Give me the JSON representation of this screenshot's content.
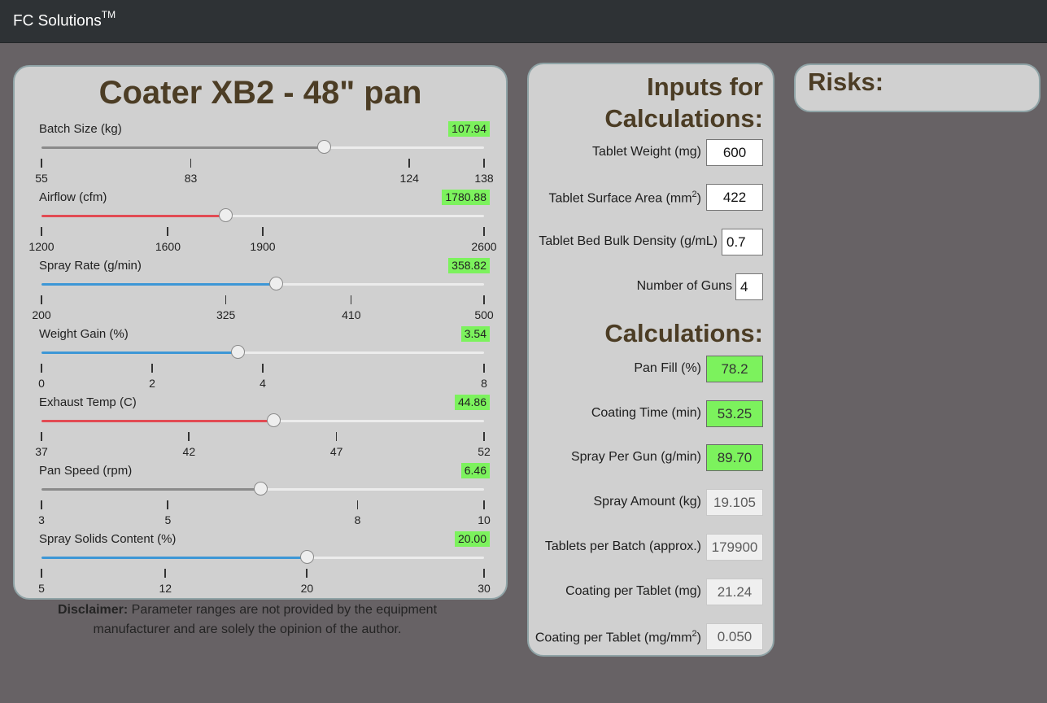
{
  "header": {
    "brand": "FC Solutions",
    "brand_mark": "TM"
  },
  "coater": {
    "title": "Coater XB2 - 48\" pan",
    "sliders": [
      {
        "label": "Batch Size (kg)",
        "value": "107.94",
        "min": 55,
        "max": 138,
        "current": 107.94,
        "fill_color": "#8a8a8a",
        "ticks": [
          "55",
          "83",
          "124",
          "138"
        ]
      },
      {
        "label": "Airflow (cfm)",
        "value": "1780.88",
        "min": 1200,
        "max": 2600,
        "current": 1780.88,
        "fill_color": "#e24b53",
        "ticks": [
          "1200",
          "1600",
          "1900",
          "2600"
        ]
      },
      {
        "label": "Spray Rate (g/min)",
        "value": "358.82",
        "min": 200,
        "max": 500,
        "current": 358.82,
        "fill_color": "#3d97d6",
        "ticks": [
          "200",
          "325",
          "410",
          "500"
        ]
      },
      {
        "label": "Weight Gain (%)",
        "value": "3.54",
        "min": 0,
        "max": 8,
        "current": 3.54,
        "fill_color": "#3d97d6",
        "ticks": [
          "0",
          "2",
          "4",
          "8"
        ]
      },
      {
        "label": "Exhaust Temp (C)",
        "value": "44.86",
        "min": 37,
        "max": 52,
        "current": 44.86,
        "fill_color": "#e24b53",
        "ticks": [
          "37",
          "42",
          "47",
          "52"
        ]
      },
      {
        "label": "Pan Speed (rpm)",
        "value": "6.46",
        "min": 3,
        "max": 10,
        "current": 6.46,
        "fill_color": "#8a8a8a",
        "ticks": [
          "3",
          "5",
          "8",
          "10"
        ]
      },
      {
        "label": "Spray Solids Content (%)",
        "value": "20.00",
        "min": 5,
        "max": 30,
        "current": 20.0,
        "fill_color": "#3d97d6",
        "ticks": [
          "5",
          "12",
          "20",
          "30"
        ]
      }
    ],
    "disclaimer_bold": "Disclaimer:",
    "disclaimer_line1": " Parameter ranges are not provided by the equipment",
    "disclaimer_line2": "manufacturer and are solely the opinion of the author."
  },
  "inputs": {
    "title_line1": "Inputs for",
    "title_line2": "Calculations:",
    "tablet_weight": {
      "label": "Tablet Weight (mg)",
      "value": "600"
    },
    "surface_area": {
      "label": "Tablet Surface Area (mm",
      "sup": "2",
      "label_end": ")",
      "value": "422"
    },
    "bulk_density": {
      "label": "Tablet Bed Bulk Density (g/mL)",
      "value": "0.7"
    },
    "num_guns": {
      "label": "Number of Guns",
      "value": "4"
    }
  },
  "calculations": {
    "title": "Calculations:",
    "pan_fill": {
      "label": "Pan Fill (%)",
      "value": "78.2"
    },
    "coating_time": {
      "label": "Coating Time (min)",
      "value": "53.25"
    },
    "spray_per_gun": {
      "label": "Spray Per Gun (g/min)",
      "value": "89.70"
    },
    "spray_amount": {
      "label": "Spray Amount (kg)",
      "value": "19.105"
    },
    "tablets_per_batch": {
      "label": "Tablets per Batch (approx.)",
      "value": "179900"
    },
    "coating_per_tablet": {
      "label": "Coating per Tablet (mg)",
      "value": "21.24"
    },
    "coating_per_area": {
      "label": "Coating per Tablet (mg/mm",
      "sup": "2",
      "label_end": ")",
      "value": "0.050"
    }
  },
  "risks": {
    "title": "Risks:"
  }
}
